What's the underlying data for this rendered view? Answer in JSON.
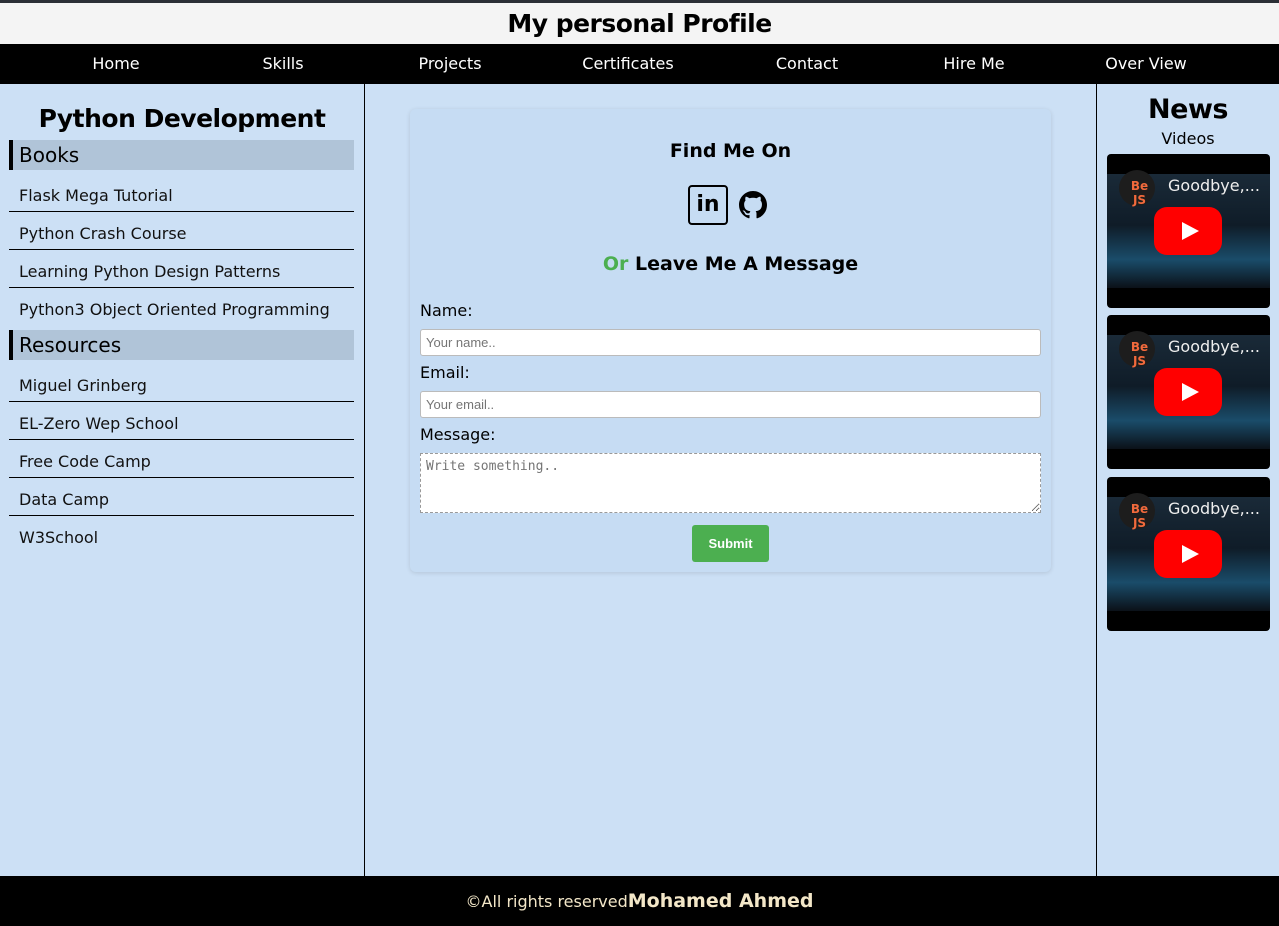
{
  "header": {
    "title": "My personal Profile"
  },
  "nav": {
    "items": [
      "Home",
      "Skills",
      "Projects",
      "Certificates",
      "Contact",
      "Hire Me",
      "Over View"
    ]
  },
  "left": {
    "title": "Python Development",
    "books": {
      "heading": "Books",
      "items": [
        "Flask Mega Tutorial",
        "Python Crash Course",
        "Learning Python Design Patterns",
        "Python3 Object Oriented Programming"
      ]
    },
    "resources": {
      "heading": "Resources",
      "items": [
        "Miguel Grinberg",
        "EL-Zero Wep School",
        "Free Code Camp",
        "Data Camp",
        "W3School"
      ]
    }
  },
  "contact": {
    "find_title": "Find Me On",
    "linkedin_icon": "linkedin-icon",
    "github_icon": "github-icon",
    "or_word": "Or",
    "leave_title": "Leave Me A Message",
    "name_label": "Name:",
    "name_placeholder": "Your name..",
    "email_label": "Email:",
    "email_placeholder": "Your email..",
    "message_label": "Message:",
    "message_placeholder": "Write something..",
    "submit_label": "Submit",
    "submit_color": "#4caf50"
  },
  "right": {
    "title": "News",
    "videos_label": "Videos",
    "videos": [
      {
        "channel": "Be JS",
        "title": "Goodbye,..."
      },
      {
        "channel": "Be JS",
        "title": "Goodbye,..."
      },
      {
        "channel": "Be JS",
        "title": "Goodbye,..."
      }
    ]
  },
  "footer": {
    "rights": "©All rights reserved",
    "author": "Mohamed Ahmed"
  }
}
